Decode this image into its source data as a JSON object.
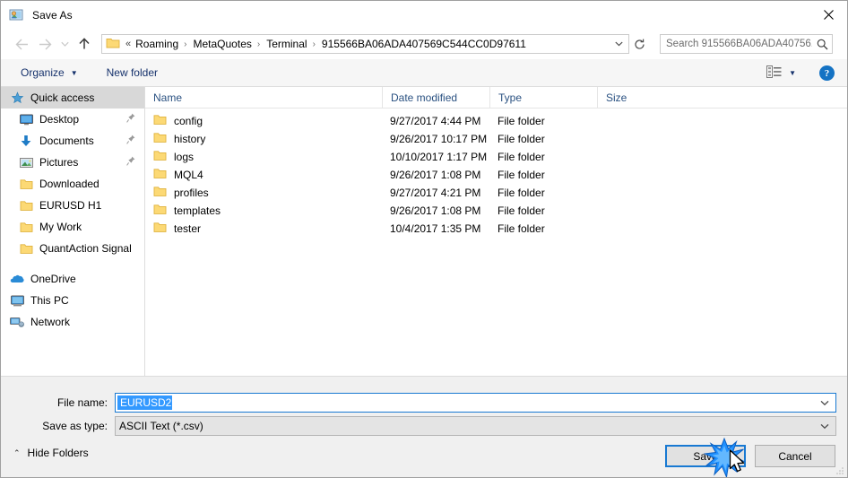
{
  "window": {
    "title": "Save As",
    "icon": "photo-person-icon",
    "close_label": "✕"
  },
  "nav": {
    "back": "←",
    "forward": "→",
    "recent_caret": "⌄",
    "up": "↑",
    "address": {
      "lead": "«",
      "crumbs": [
        "Roaming",
        "MetaQuotes",
        "Terminal",
        "915566BA06ADA407569C544CC0D97611"
      ],
      "separator": "›",
      "dropdown_caret": "⌄",
      "refresh": "↻"
    },
    "search": {
      "placeholder": "Search 915566BA06ADA40756...",
      "icon": "search-icon"
    }
  },
  "toolbar": {
    "organize_label": "Organize",
    "organize_caret": "▼",
    "new_folder_label": "New folder",
    "view_caret": "▼",
    "help_label": "?"
  },
  "sidebar": {
    "items": [
      {
        "label": "Quick access",
        "icon": "star-icon",
        "selected": true,
        "pinned": false,
        "level": "root"
      },
      {
        "label": "Desktop",
        "icon": "monitor-icon",
        "selected": false,
        "pinned": true,
        "level": "child"
      },
      {
        "label": "Documents",
        "icon": "download-arrow-icon",
        "selected": false,
        "pinned": true,
        "level": "child"
      },
      {
        "label": "Pictures",
        "icon": "picture-icon",
        "selected": false,
        "pinned": true,
        "level": "child"
      },
      {
        "label": "Downloaded",
        "icon": "folder-icon",
        "selected": false,
        "pinned": false,
        "level": "child"
      },
      {
        "label": "EURUSD H1",
        "icon": "folder-icon",
        "selected": false,
        "pinned": false,
        "level": "child"
      },
      {
        "label": "My Work",
        "icon": "folder-icon",
        "selected": false,
        "pinned": false,
        "level": "child"
      },
      {
        "label": "QuantAction Signal",
        "icon": "folder-icon",
        "selected": false,
        "pinned": false,
        "level": "child"
      },
      {
        "label": "OneDrive",
        "icon": "cloud-icon",
        "selected": false,
        "pinned": false,
        "level": "group"
      },
      {
        "label": "This PC",
        "icon": "pc-icon",
        "selected": false,
        "pinned": false,
        "level": "group"
      },
      {
        "label": "Network",
        "icon": "network-icon",
        "selected": false,
        "pinned": false,
        "level": "group"
      }
    ],
    "pin_glyph": "📌"
  },
  "filelist": {
    "columns": {
      "name": "Name",
      "date_modified": "Date modified",
      "type": "Type",
      "size": "Size"
    },
    "sort_indicator": "⌃",
    "rows": [
      {
        "name": "config",
        "date": "9/27/2017 4:44 PM",
        "type": "File folder",
        "size": ""
      },
      {
        "name": "history",
        "date": "9/26/2017 10:17 PM",
        "type": "File folder",
        "size": ""
      },
      {
        "name": "logs",
        "date": "10/10/2017 1:17 PM",
        "type": "File folder",
        "size": ""
      },
      {
        "name": "MQL4",
        "date": "9/26/2017 1:08 PM",
        "type": "File folder",
        "size": ""
      },
      {
        "name": "profiles",
        "date": "9/27/2017 4:21 PM",
        "type": "File folder",
        "size": ""
      },
      {
        "name": "templates",
        "date": "9/26/2017 1:08 PM",
        "type": "File folder",
        "size": ""
      },
      {
        "name": "tester",
        "date": "10/4/2017 1:35 PM",
        "type": "File folder",
        "size": ""
      }
    ]
  },
  "form": {
    "filename_label": "File name:",
    "filename_value": "EURUSD2",
    "filetype_label": "Save as type:",
    "filetype_value": "ASCII Text (*.csv)",
    "dropdown_caret": "⌄"
  },
  "footer": {
    "hide_folders_label": "Hide Folders",
    "hide_folders_caret": "⌃",
    "save_label": "Save",
    "cancel_label": "Cancel"
  },
  "colors": {
    "accent_blue": "#1879d2",
    "selection_blue": "#3399ff",
    "folder_yellow": "#fcd975",
    "link_blue": "#16326c",
    "column_header_blue": "#2a5181"
  }
}
